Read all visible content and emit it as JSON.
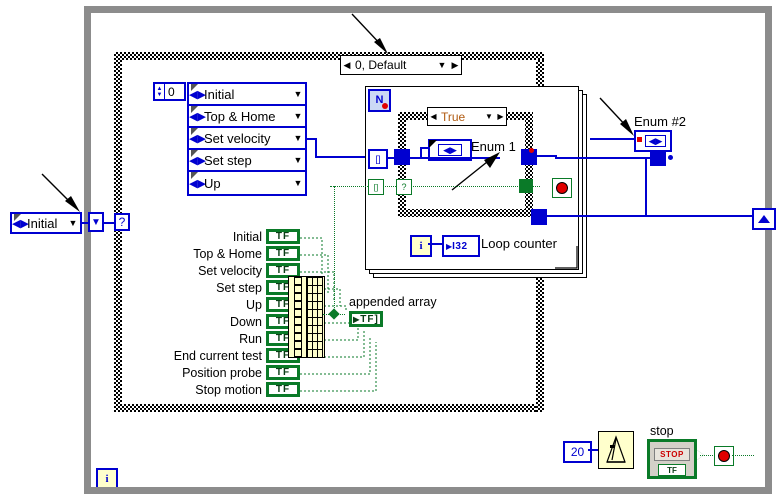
{
  "window": {
    "title_bar": false
  },
  "top_case_selector": {
    "label": "0, Default",
    "left_arrow": "◀",
    "right_arrow": "▶",
    "down_arrow": "▼"
  },
  "left_control": {
    "label": "Initial",
    "glyph": "◀▶",
    "arrow": "▼"
  },
  "numeric_constant": {
    "value": "0"
  },
  "enum_list": [
    {
      "label": "Initial"
    },
    {
      "label": "Top & Home"
    },
    {
      "label": "Set velocity"
    },
    {
      "label": "Set step"
    },
    {
      "label": "Up"
    }
  ],
  "inner_case": {
    "label": "True",
    "left_arrow": "◀",
    "right_arrow": "▶",
    "down_arrow": "▼"
  },
  "enum1": {
    "label": "Enum 1"
  },
  "enum2": {
    "label": "Enum #2"
  },
  "loop_counter": {
    "i_label": "i",
    "type_label": "I32",
    "label": "Loop counter"
  },
  "case_selector_terminal": {
    "glyph": "?"
  },
  "bottom_i_terminal": {
    "glyph": "i"
  },
  "booleans": [
    {
      "label": "Initial",
      "value": "TF"
    },
    {
      "label": "Top & Home",
      "value": "TF"
    },
    {
      "label": "Set velocity",
      "value": "TF"
    },
    {
      "label": "Set step",
      "value": "TF"
    },
    {
      "label": "Up",
      "value": "TF"
    },
    {
      "label": "Down",
      "value": "TF"
    },
    {
      "label": "Run",
      "value": "TF"
    },
    {
      "label": "End current test",
      "value": "TF"
    },
    {
      "label": "Position probe",
      "value": "TF"
    },
    {
      "label": "Stop motion",
      "value": "TF"
    }
  ],
  "build_array": {
    "input_count": 10
  },
  "appended_array": {
    "label": "appended array",
    "value": "TF]"
  },
  "wait_node": {
    "constant": "20",
    "icon": "metronome-icon"
  },
  "stop_control": {
    "label": "stop",
    "button_text": "STOP",
    "type_label": "TF"
  },
  "colors": {
    "blue": "#0000d0",
    "green": "#0a7a28",
    "frame_gray": "#8c8c8c",
    "case_text_orange": "#b05a10",
    "array_fill": "#ffffcc",
    "metronome_fill": "#ffffcc",
    "red": "#e00000"
  }
}
